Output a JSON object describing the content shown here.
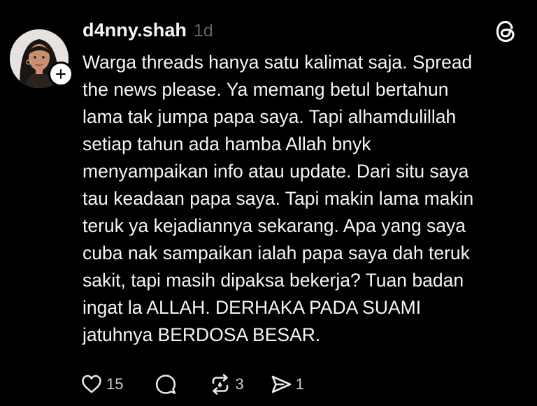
{
  "post": {
    "username": "d4nny.shah",
    "time": "1d",
    "text_lines": [
      "Warga threads hanya satu kalimat saja. Spread",
      "the news please. Ya memang betul bertahun",
      "lama tak jumpa papa saya. Tapi alhamdulillah",
      "setiap tahun ada hamba Allah bnyk",
      "menyampaikan info atau update. Dari situ saya",
      "tau keadaan papa saya. Tapi makin lama makin",
      "teruk ya kejadiannya sekarang. Apa yang saya",
      "cuba nak sampaikan ialah papa saya dah teruk",
      "sakit, tapi masih dipaksa bekerja? Tuan badan",
      "ingat la ALLAH. DERHAKA PADA SUAMI",
      "jatuhnya BERDOSA BESAR."
    ]
  },
  "actions": {
    "likes": "15",
    "reposts": "3",
    "shares": "1"
  },
  "icons": {
    "avatar": "profile-photo",
    "follow": "plus-icon",
    "app": "threads-logo-icon",
    "like": "heart-icon",
    "comment": "comment-icon",
    "repost": "repost-icon",
    "share": "send-icon"
  },
  "colors": {
    "background": "#000000",
    "text": "#f3f5f7",
    "muted": "#616161"
  }
}
